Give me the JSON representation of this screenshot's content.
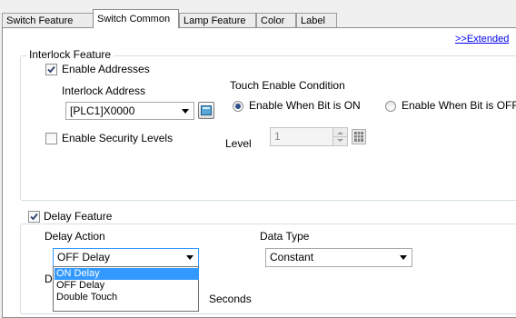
{
  "tabs": [
    {
      "label": "Switch Feature",
      "active": false
    },
    {
      "label": "Switch Common",
      "active": true
    },
    {
      "label": "Lamp Feature",
      "active": false
    },
    {
      "label": "Color",
      "active": false
    },
    {
      "label": "Label",
      "active": false
    }
  ],
  "extended_link": ">>Extended",
  "interlock": {
    "title": "Interlock Feature",
    "enable_addresses_label": "Enable Addresses",
    "enable_addresses_checked": true,
    "interlock_address_label": "Interlock Address",
    "interlock_address_value": "[PLC1]X0000",
    "touch_enable_condition_label": "Touch Enable Condition",
    "radio_on_label": "Enable When Bit is ON",
    "radio_off_label": "Enable When Bit is OFF",
    "radio_selected": "on",
    "enable_security_label": "Enable Security Levels",
    "enable_security_checked": false,
    "level_label": "Level",
    "level_value": "1"
  },
  "delay": {
    "title": "Delay Feature",
    "checked": true,
    "delay_action_label": "Delay Action",
    "delay_action_value": "OFF Delay",
    "data_type_label": "Data Type",
    "data_type_value": "Constant",
    "hidden_label_start": "D",
    "seconds_label": "Seconds",
    "options": [
      {
        "label": "ON Delay",
        "selected": true
      },
      {
        "label": "OFF Delay",
        "selected": false
      },
      {
        "label": "Double Touch",
        "selected": false
      }
    ]
  },
  "colors": {
    "accent": "#3399ff",
    "link": "#0000ee",
    "radio_dot": "#2c4f8a"
  }
}
